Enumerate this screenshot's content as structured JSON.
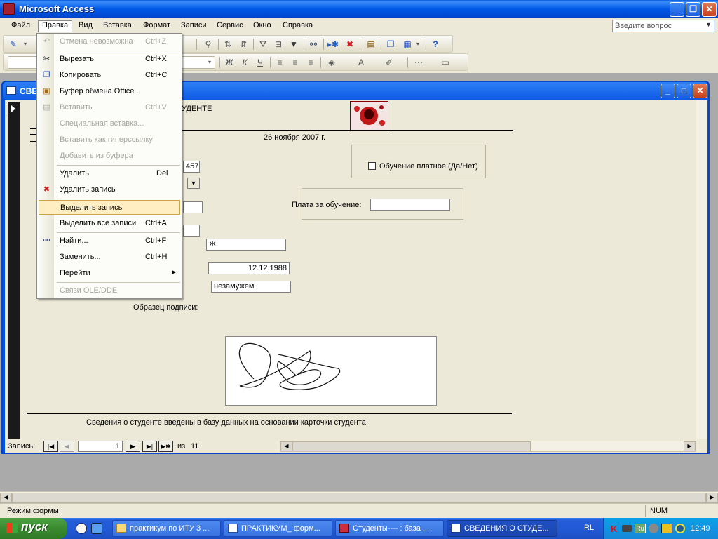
{
  "app": {
    "title": "Microsoft Access"
  },
  "menubar": {
    "items": [
      "Файл",
      "Правка",
      "Вид",
      "Вставка",
      "Формат",
      "Записи",
      "Сервис",
      "Окно",
      "Справка"
    ],
    "help_placeholder": "Введите вопрос"
  },
  "edit_menu": {
    "items": [
      {
        "label": "Отмена невозможна",
        "shortcut": "Ctrl+Z",
        "enabled": false,
        "icon": "undo-icon"
      },
      {
        "label": "Вырезать",
        "shortcut": "Ctrl+X",
        "enabled": true,
        "icon": "scissors-icon"
      },
      {
        "label": "Копировать",
        "shortcut": "Ctrl+C",
        "enabled": true,
        "icon": "copy-icon"
      },
      {
        "label": "Буфер обмена Office...",
        "shortcut": "",
        "enabled": true,
        "icon": "clipboard-icon"
      },
      {
        "label": "Вставить",
        "shortcut": "Ctrl+V",
        "enabled": false,
        "icon": "paste-icon"
      },
      {
        "label": "Специальная вставка...",
        "shortcut": "",
        "enabled": false,
        "icon": ""
      },
      {
        "label": "Вставить как гиперссылку",
        "shortcut": "",
        "enabled": false,
        "icon": ""
      },
      {
        "label": "Добавить из буфера",
        "shortcut": "",
        "enabled": false,
        "icon": ""
      },
      {
        "label": "Удалить",
        "shortcut": "Del",
        "enabled": true,
        "icon": ""
      },
      {
        "label": "Удалить запись",
        "shortcut": "",
        "enabled": true,
        "icon": "delete-record-icon"
      },
      {
        "label": "Выделить запись",
        "shortcut": "",
        "enabled": true,
        "icon": ""
      },
      {
        "label": "Выделить все записи",
        "shortcut": "Ctrl+A",
        "enabled": true,
        "icon": ""
      },
      {
        "label": "Найти...",
        "shortcut": "Ctrl+F",
        "enabled": true,
        "icon": "binoculars-icon"
      },
      {
        "label": "Заменить...",
        "shortcut": "Ctrl+H",
        "enabled": true,
        "icon": ""
      },
      {
        "label": "Перейти",
        "shortcut": "",
        "enabled": true,
        "icon": ""
      },
      {
        "label": "Связи OLE/DDE",
        "shortcut": "",
        "enabled": false,
        "icon": ""
      }
    ]
  },
  "child_window": {
    "title": "СВЕДЕНИЯ О СТУДЕНТЕ"
  },
  "form": {
    "heading_fragment": "УДЕНТЕ",
    "date": "26 ноября 2007 г.",
    "field_number_fragment": "457",
    "paid_checkbox_label": "Обучение платное (Да/Нет)",
    "fee_label": "Плата за обучение:",
    "fee_value": "",
    "gender_value": "Ж",
    "birthdate_value": "12.12.1988",
    "marital_value": "незамужем",
    "signature_label": "Образец подписи:",
    "footer_note": "Сведения о студенте введены в базу данных на основании карточки студента"
  },
  "navigation": {
    "label": "Запись:",
    "current": "1",
    "of_label": "из",
    "total": "11"
  },
  "status": {
    "mode": "Режим формы",
    "num": "NUM"
  },
  "taskbar": {
    "start_label": "пуск",
    "tasks": [
      "практикум по ИТУ 3 ...",
      "ПРАКТИКУМ_ форм...",
      "Студенты---- : база ...",
      "СВЕДЕНИЯ О СТУДЕ..."
    ],
    "language": "RL",
    "clock": "12:49"
  }
}
